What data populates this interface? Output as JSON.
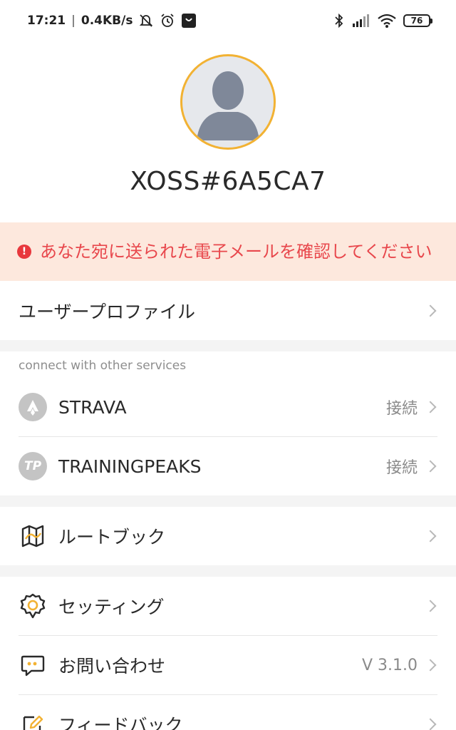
{
  "status_bar": {
    "time": "17:21",
    "speed": "0.4KB/s",
    "battery": "76"
  },
  "profile": {
    "username": "XOSS#6A5CA7"
  },
  "alert": {
    "message": "あなた宛に送られた電子メールを確認してください"
  },
  "menu": {
    "user_profile": "ユーザープロファイル",
    "connect_title": "connect with other services",
    "strava_label": "STRAVA",
    "strava_status": "接続",
    "tp_label": "TRAININGPEAKS",
    "tp_status": "接続",
    "routebook": "ルートブック",
    "settings": "セッティング",
    "contact": "お問い合わせ",
    "version": "V 3.1.0",
    "feedback": "フィードバック"
  },
  "colors": {
    "avatar_ring": "#f2b233",
    "alert_bg": "#fde8dd",
    "alert_text": "#e8474c",
    "accent_icon": "#f2b233"
  }
}
